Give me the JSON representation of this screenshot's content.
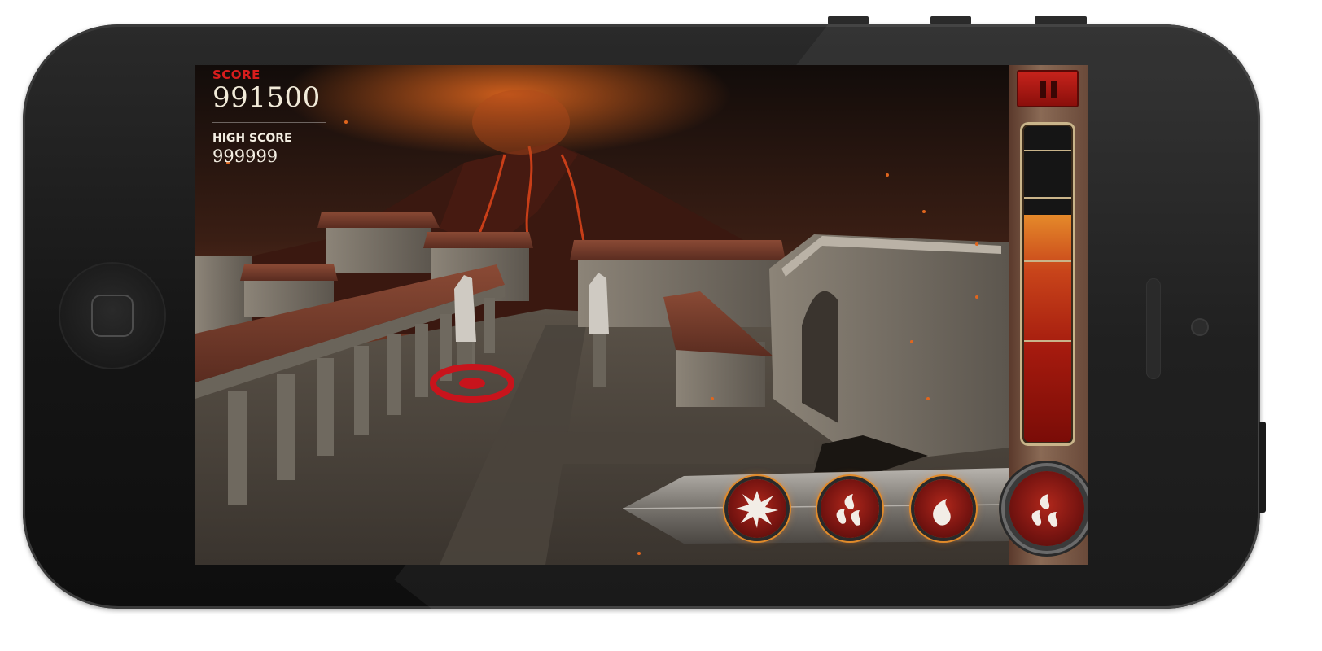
{
  "hud": {
    "score_label": "SCORE",
    "score_value": "991500",
    "high_score_label": "HIGH SCORE",
    "high_score_value": "999999"
  },
  "gauge": {
    "fill_fraction": 0.7
  },
  "abilities": [
    {
      "name": "explosion-ability",
      "icon": "burst-icon"
    },
    {
      "name": "triple-fire-ability",
      "icon": "triple-flame-icon"
    },
    {
      "name": "fire-ability",
      "icon": "flame-icon"
    },
    {
      "name": "multi-fire-ability",
      "icon": "triple-flame-icon"
    }
  ],
  "colors": {
    "score_label": "#d81d1d",
    "hud_text": "#f1ead8",
    "lava": "#c8441a",
    "ability_glow": "#e08a2a"
  }
}
